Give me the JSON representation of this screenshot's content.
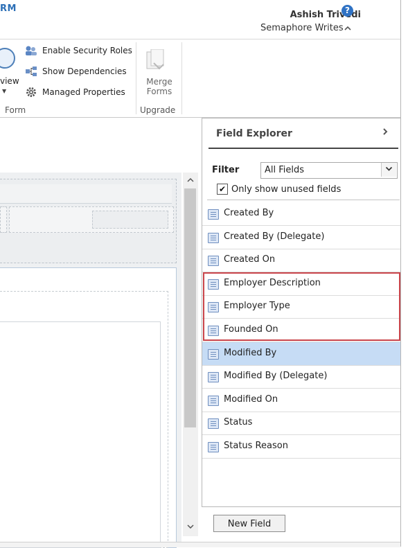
{
  "header": {
    "app_title": "RM",
    "user_name": "Ashish Trivedi",
    "org_name": "Semaphore Writes",
    "help_icon": "question-circle-icon",
    "collapse_icon": "chevron-up-icon"
  },
  "ribbon": {
    "preview_label": "view",
    "items": [
      {
        "label": "Enable Security Roles",
        "icon": "security-roles-icon"
      },
      {
        "label": "Show Dependencies",
        "icon": "dependencies-icon"
      },
      {
        "label": "Managed Properties",
        "icon": "gear-icon"
      }
    ],
    "form_group_label": "Form",
    "merge_forms_label": "Merge Forms",
    "upgrade_group_label": "Upgrade"
  },
  "field_explorer": {
    "title": "Field Explorer",
    "expand_icon": "chevron-right-icon",
    "filter_label": "Filter",
    "filter_value": "All Fields",
    "only_unused_label": "Only show unused fields",
    "only_unused_checked": true,
    "fields": [
      {
        "label": "Created By",
        "selected": false,
        "highlighted": false
      },
      {
        "label": "Created By (Delegate)",
        "selected": false,
        "highlighted": false
      },
      {
        "label": "Created On",
        "selected": false,
        "highlighted": false
      },
      {
        "label": "Employer Description",
        "selected": false,
        "highlighted": true
      },
      {
        "label": "Employer Type",
        "selected": false,
        "highlighted": true
      },
      {
        "label": "Founded On",
        "selected": false,
        "highlighted": true
      },
      {
        "label": "Modified By",
        "selected": true,
        "highlighted": false
      },
      {
        "label": "Modified By (Delegate)",
        "selected": false,
        "highlighted": false
      },
      {
        "label": "Modified On",
        "selected": false,
        "highlighted": false
      },
      {
        "label": "Status",
        "selected": false,
        "highlighted": false
      },
      {
        "label": "Status Reason",
        "selected": false,
        "highlighted": false
      }
    ],
    "new_field_label": "New Field",
    "highlight_color": "#c9444a",
    "selected_color": "#c6dcf5"
  }
}
